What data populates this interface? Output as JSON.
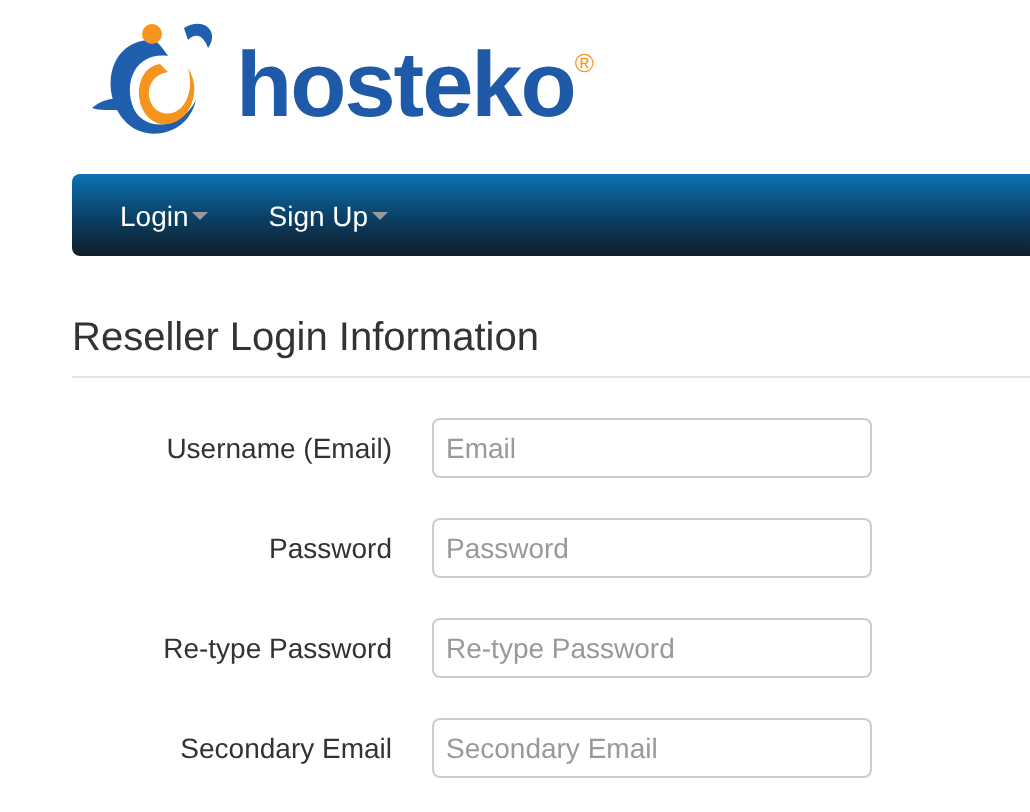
{
  "logo": {
    "wordmark": "hosteko",
    "registered": "®"
  },
  "nav": [
    {
      "label": "Login",
      "has_dropdown": true
    },
    {
      "label": "Sign Up",
      "has_dropdown": true
    }
  ],
  "heading": "Reseller Login Information",
  "fields": [
    {
      "label": "Username (Email)",
      "placeholder": "Email"
    },
    {
      "label": "Password",
      "placeholder": "Password"
    },
    {
      "label": "Re-type Password",
      "placeholder": "Re-type Password"
    },
    {
      "label": "Secondary Email",
      "placeholder": "Secondary Email"
    }
  ]
}
